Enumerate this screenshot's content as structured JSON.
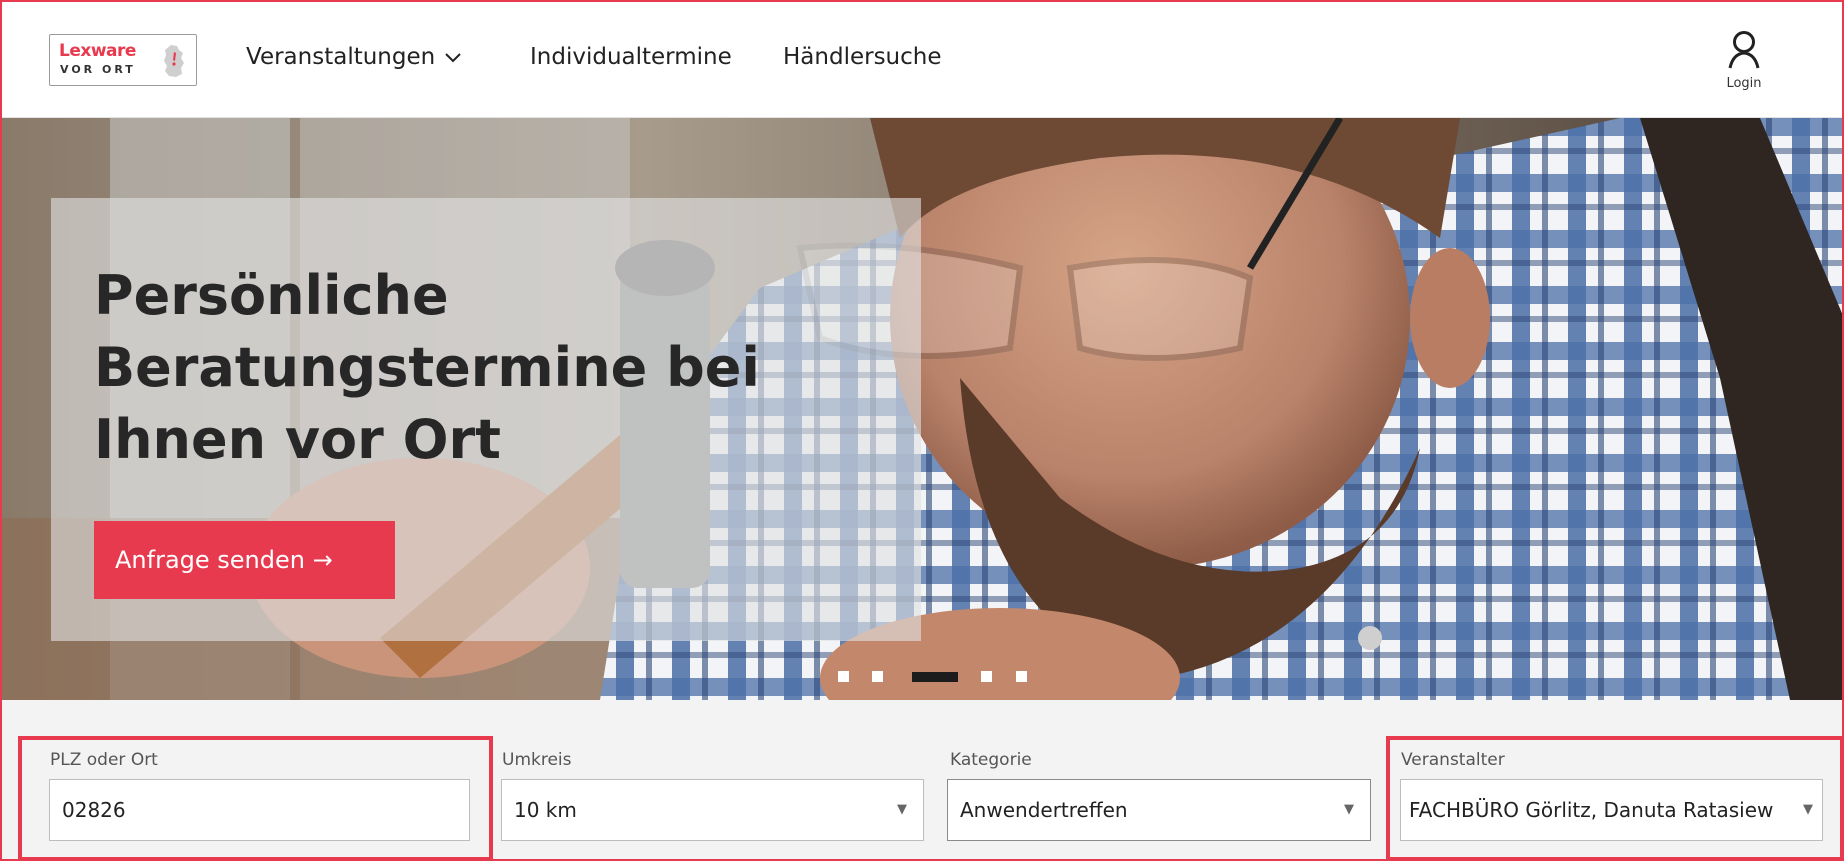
{
  "header": {
    "logo": {
      "brand": "Lexware",
      "sub": "VOR ORT"
    },
    "nav": [
      {
        "label": "Veranstaltungen",
        "has_dropdown": true
      },
      {
        "label": "Individualtermine"
      },
      {
        "label": "Händlersuche"
      }
    ],
    "login_label": "Login"
  },
  "hero": {
    "headline_lines": [
      "Persönliche",
      "Beratungstermine bei",
      "Ihnen vor Ort"
    ],
    "cta_label": "Anfrage senden →",
    "carousel": {
      "slides": 5,
      "active_index": 2
    }
  },
  "filters": {
    "location": {
      "label": "PLZ oder Ort",
      "value": "02826"
    },
    "radius": {
      "label": "Umkreis",
      "value": "10 km"
    },
    "category": {
      "label": "Kategorie",
      "value": "Anwendertreffen"
    },
    "organizer": {
      "label": "Veranstalter",
      "value": "FACHBÜRO Görlitz, Danuta Ratasiew"
    }
  },
  "colors": {
    "accent": "#e83a4e",
    "text": "#272727"
  }
}
